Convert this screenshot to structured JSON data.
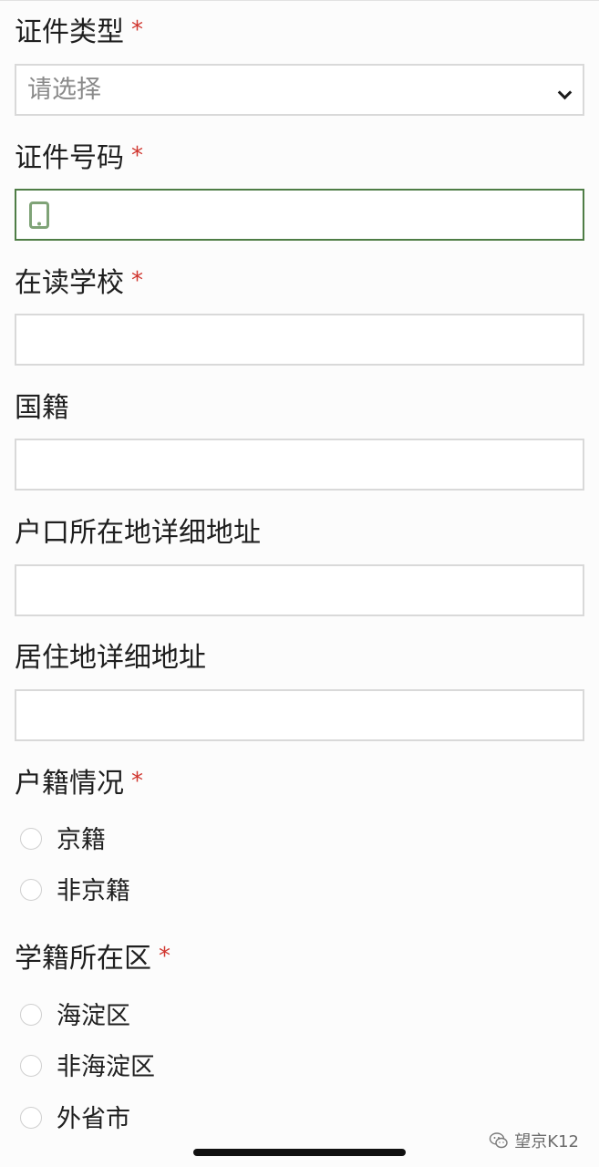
{
  "form": {
    "id_type": {
      "label": "证件类型",
      "required_mark": "*",
      "placeholder": "请选择"
    },
    "id_number": {
      "label": "证件号码",
      "required_mark": "*",
      "value": ""
    },
    "school": {
      "label": "在读学校",
      "required_mark": "*",
      "value": ""
    },
    "nationality": {
      "label": "国籍",
      "value": ""
    },
    "hukou_address": {
      "label": "户口所在地详细地址",
      "value": ""
    },
    "residence_address": {
      "label": "居住地详细地址",
      "value": ""
    },
    "hukou_status": {
      "label": "户籍情况",
      "required_mark": "*",
      "options": [
        "京籍",
        "非京籍"
      ]
    },
    "school_district": {
      "label": "学籍所在区",
      "required_mark": "*",
      "options": [
        "海淀区",
        "非海淀区",
        "外省市"
      ]
    }
  },
  "watermark": {
    "text": "望京K12"
  },
  "colors": {
    "required": "#d0362f",
    "focus_border": "#4f7d46",
    "icon_green": "#7fa377"
  },
  "icons": {
    "select_arrow": "chevron-down-icon",
    "id_number_field": "mobile-phone-icon",
    "watermark": "wechat-icon"
  }
}
